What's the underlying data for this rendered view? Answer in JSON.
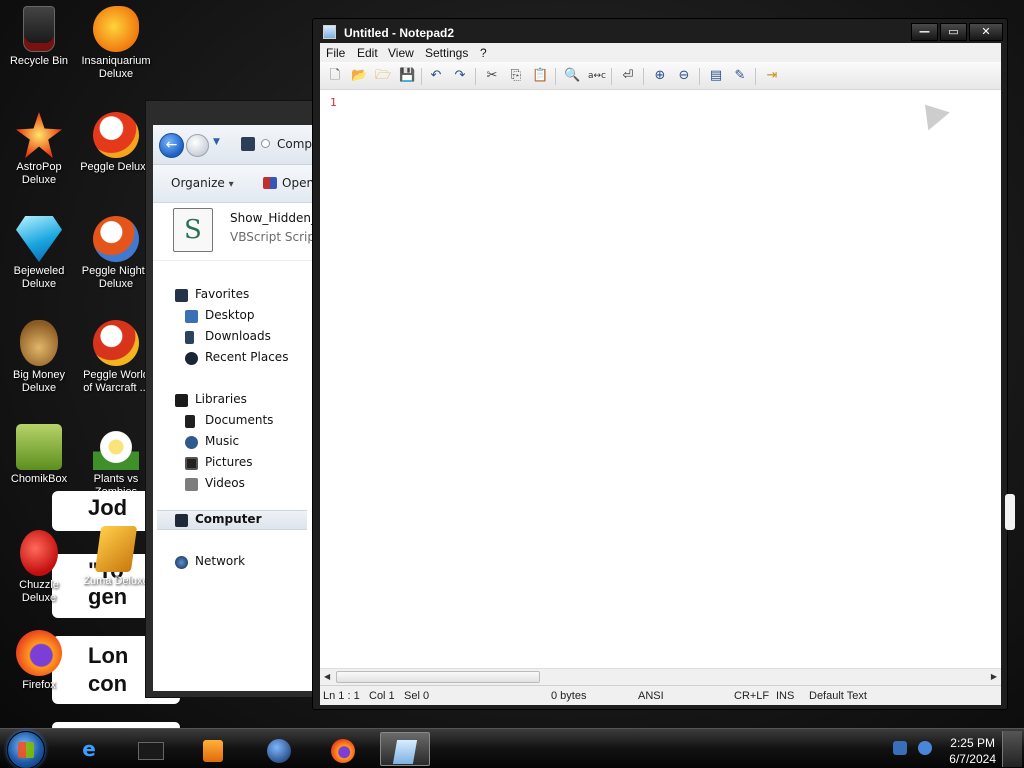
{
  "desktop": {
    "icons": [
      {
        "label": "Recycle Bin",
        "icon": "recycle-bin-icon"
      },
      {
        "label": "Insaniquarium Deluxe",
        "icon": "fish-icon"
      },
      {
        "label": "AstroPop Deluxe",
        "icon": "astropop-icon"
      },
      {
        "label": "Peggle Deluxe",
        "icon": "peggle-icon"
      },
      {
        "label": "Bejeweled Deluxe",
        "icon": "gem-icon"
      },
      {
        "label": "Peggle Nights Deluxe",
        "icon": "peggle-nights-icon"
      },
      {
        "label": "Big Money Deluxe",
        "icon": "money-bag-icon"
      },
      {
        "label": "Peggle World of Warcraft ...",
        "icon": "peggle-wow-icon"
      },
      {
        "label": "ChomikBox",
        "icon": "chomikbox-icon"
      },
      {
        "label": "Plants vs Zombies",
        "icon": "flower-icon"
      },
      {
        "label": "Chuzzle Deluxe",
        "icon": "chuzzle-icon"
      },
      {
        "label": "Zuma Deluxe",
        "icon": "zuma-icon"
      },
      {
        "label": "Firefox",
        "icon": "firefox-icon"
      }
    ],
    "banners": [
      "Jod",
      "\"To\ngen",
      "Lon\ncon"
    ]
  },
  "explorer": {
    "address": "Comp",
    "toolbar": {
      "organize": "Organize",
      "organize_arrow": "▾",
      "open": "Open"
    },
    "file": {
      "name": "Show_Hidden_",
      "type": "VBScript Script"
    },
    "nav": {
      "favorites": "Favorites",
      "desktop": "Desktop",
      "downloads": "Downloads",
      "recent": "Recent Places",
      "libraries": "Libraries",
      "documents": "Documents",
      "music": "Music",
      "pictures": "Pictures",
      "videos": "Videos",
      "computer": "Computer",
      "network": "Network"
    }
  },
  "notepad": {
    "title": "Untitled - Notepad2",
    "menu": [
      "File",
      "Edit",
      "View",
      "Settings",
      "?"
    ],
    "editor": {
      "line_number": "1"
    },
    "status": {
      "position": "Ln 1 : 1",
      "column": "Col 1",
      "selection": "Sel 0",
      "size": "0 bytes",
      "encoding": "ANSI",
      "line_endings": "CR+LF",
      "insert_mode": "INS",
      "scheme": "Default Text"
    },
    "window_buttons": {
      "minimize": "—",
      "maximize": "▭",
      "close": "✕"
    }
  },
  "taskbar": {
    "apps": [
      "internet-explorer-icon",
      "explorer-icon",
      "media-player-icon",
      "globe-icon",
      "firefox-icon",
      "notepad-icon"
    ],
    "clock": {
      "time": "2:25 PM",
      "date": "6/7/2024"
    }
  },
  "colors": {
    "accent": "#1e5aa8",
    "line_number": "#d62b2b"
  }
}
